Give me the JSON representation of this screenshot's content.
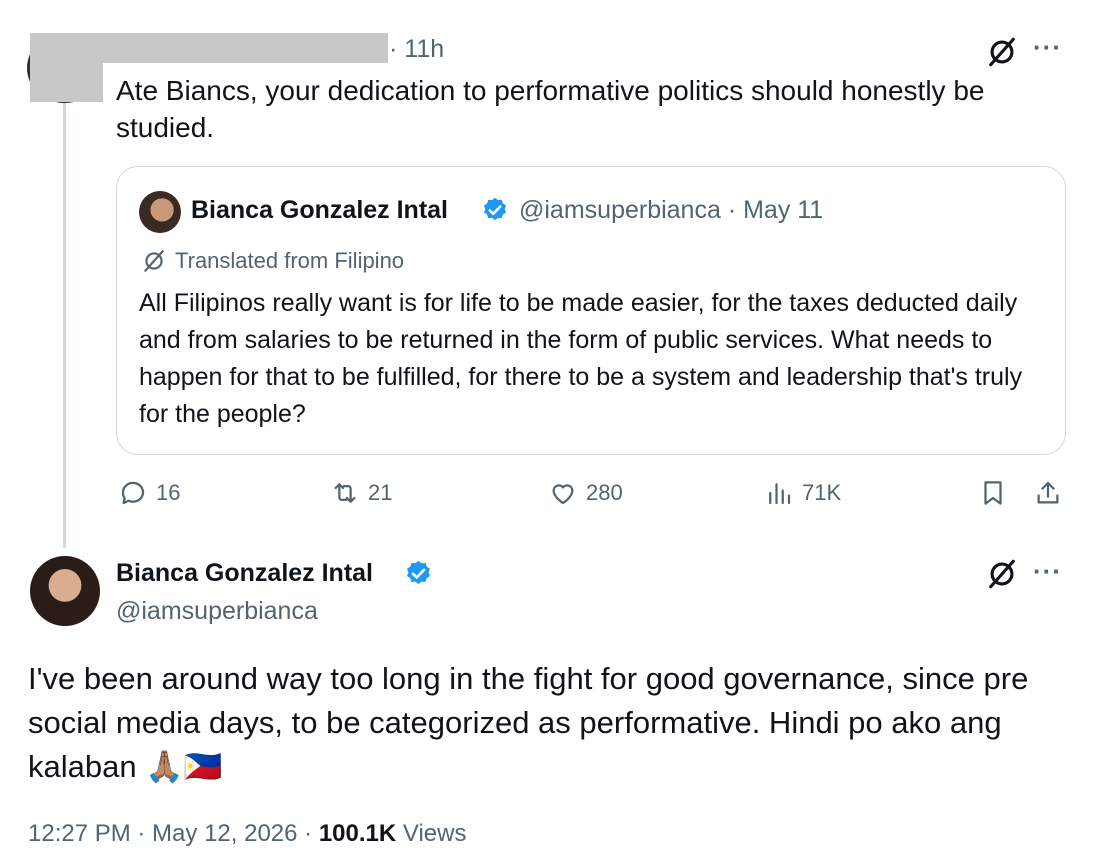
{
  "reply_post": {
    "time": "· 11h",
    "text": "Ate Biancs, your dedication to performative politics should honestly be studied."
  },
  "quoted_post": {
    "author_name": "Bianca Gonzalez Intal",
    "author_handle": "@iamsuperbianca · May 11",
    "translated_label": "Translated from Filipino",
    "text": "All Filipinos really want is for life to be made easier, for the taxes deducted daily and from salaries to be returned in the form of public services. What needs to happen for that to be fulfilled, for there to be a system and leadership that's truly for the people?"
  },
  "actions": {
    "replies": "16",
    "reposts": "21",
    "likes": "280",
    "views": "71K"
  },
  "main_post": {
    "author_name": "Bianca Gonzalez Intal",
    "author_handle": "@iamsuperbianca",
    "text": "I've been around way too long in the fight for good governance, since pre social media days, to be categorized as performative. Hindi po ako ang kalaban 🙏🏽🇵🇭",
    "timestamp": "12:27 PM · May 12, 2026 · ",
    "views_count": "100.1K",
    "views_label": " Views"
  },
  "colors": {
    "verified": "#1d9bf0",
    "muted_text": "#536471",
    "border": "#cfd9de"
  },
  "icons": [
    "grok-icon",
    "more-icon",
    "verified-icon",
    "reply-icon",
    "repost-icon",
    "like-icon",
    "views-icon",
    "bookmark-icon",
    "share-icon",
    "translate-icon"
  ]
}
